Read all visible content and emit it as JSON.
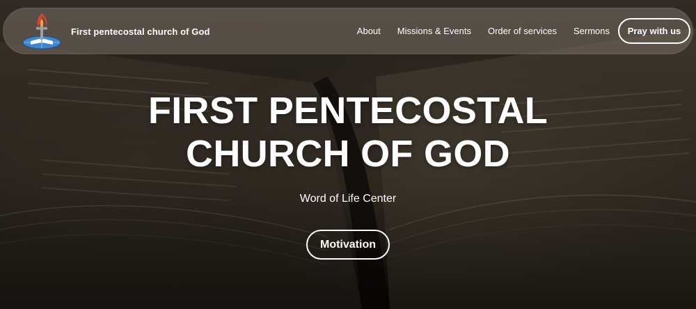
{
  "site": {
    "brand_name": "First pentecostal church of God",
    "logo_icon": "flame-cross-globe-icon"
  },
  "nav": {
    "items": [
      {
        "label": "About"
      },
      {
        "label": "Missions & Events"
      },
      {
        "label": "Order of services"
      },
      {
        "label": "Sermons"
      }
    ],
    "cta_label": "Pray with us"
  },
  "hero": {
    "title_line1": "FIRST PENTECOSTAL",
    "title_line2": "CHURCH OF GOD",
    "subtitle": "Word of Life Center",
    "button_label": "Motivation",
    "background": "open-bible-photo"
  },
  "colors": {
    "text": "#ffffff",
    "navbar_bg": "#786f66",
    "logo_flame": "#d9442e",
    "logo_globe": "#3f86d1"
  }
}
